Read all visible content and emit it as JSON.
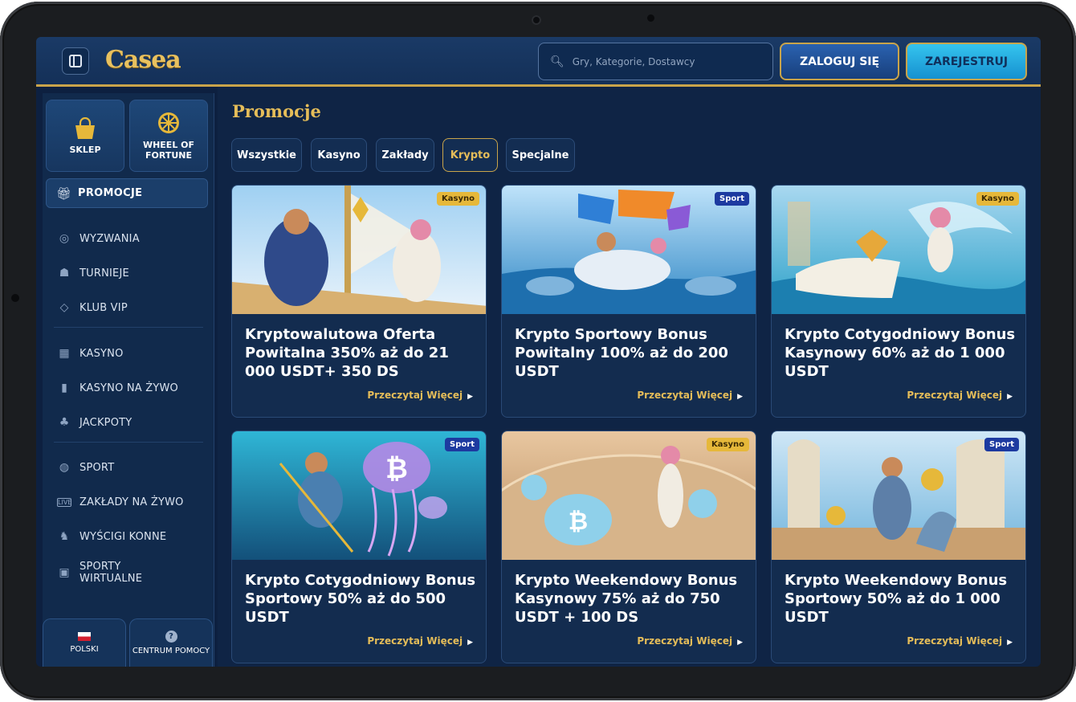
{
  "header": {
    "logo": "Casea",
    "search_placeholder": "Gry, Kategorie, Dostawcy",
    "login_label": "ZALOGUJ SIĘ",
    "register_label": "ZAREJESTRUJ"
  },
  "sidebar": {
    "quick": [
      {
        "label": "SKLEP",
        "icon": "shopping-bag-icon"
      },
      {
        "label": "WHEEL OF FORTUNE",
        "icon": "wheel-icon"
      }
    ],
    "promo": {
      "label": "PROMOCJE",
      "icon": "gift-icon"
    },
    "items": [
      {
        "label": "WYZWANIA",
        "icon": "medal-icon"
      },
      {
        "label": "TURNIEJE",
        "icon": "trophy-icon"
      },
      {
        "label": "KLUB VIP",
        "icon": "diamond-icon"
      },
      {
        "label": "KASYNO",
        "icon": "slot-machine-icon"
      },
      {
        "label": "KASYNO NA ŻYWO",
        "icon": "live-dealer-icon"
      },
      {
        "label": "JACKPOTY",
        "icon": "clover-icon"
      },
      {
        "label": "SPORT",
        "icon": "ball-icon"
      },
      {
        "label": "ZAKŁADY NA ŻYWO",
        "icon": "live-icon"
      },
      {
        "label": "WYŚCIGI KONNE",
        "icon": "horse-icon"
      },
      {
        "label": "SPORTY WIRTUALNE",
        "icon": "virtual-icon"
      }
    ],
    "footer": {
      "language_label": "POLSKI",
      "help_label": "CENTRUM POMOCY"
    }
  },
  "main": {
    "title": "Promocje",
    "filters": [
      {
        "label": "Wszystkie",
        "active": false
      },
      {
        "label": "Kasyno",
        "active": false
      },
      {
        "label": "Zakłady",
        "active": false
      },
      {
        "label": "Krypto",
        "active": true
      },
      {
        "label": "Specjalne",
        "active": false
      }
    ],
    "read_more": "Przeczytaj Więcej",
    "cards": [
      {
        "badge": "Kasyno",
        "title": "Kryptowalutowa Oferta Powitalna 350% aż do 21 000 USDT+ 350 DS"
      },
      {
        "badge": "Sport",
        "title": "Krypto Sportowy Bonus Powitalny 100% aż do 200 USDT"
      },
      {
        "badge": "Kasyno",
        "title": "Krypto Cotygodniowy Bonus Kasynowy 60% aż do 1 000 USDT"
      },
      {
        "badge": "Sport",
        "title": "Krypto Cotygodniowy Bonus Sportowy 50% aż do 500 USDT"
      },
      {
        "badge": "Kasyno",
        "title": "Krypto Weekendowy Bonus Kasynowy 75% aż do 750 USDT + 100 DS"
      },
      {
        "badge": "Sport",
        "title": "Krypto Weekendowy Bonus Sportowy 50% aż do 1 000 USDT"
      }
    ]
  },
  "colors": {
    "accent_gold": "#e5bd59",
    "navy": "#0f2445",
    "sport_badge": "#1d3aa0",
    "kasyno_badge": "#e6b83a"
  }
}
